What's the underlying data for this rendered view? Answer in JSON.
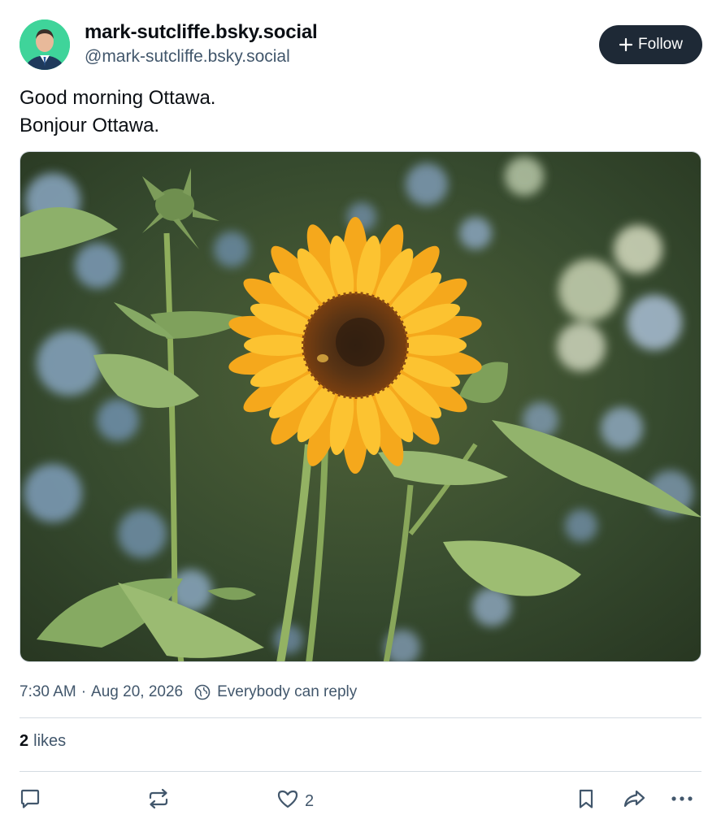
{
  "author": {
    "display_name": "mark-sutcliffe.bsky.social",
    "handle": "@mark-sutcliffe.bsky.social",
    "avatar_icon": "user-avatar",
    "avatar_bg": "#3fd49a"
  },
  "follow_button": {
    "label": "Follow",
    "icon": "plus-icon",
    "bg": "#1e2936"
  },
  "post": {
    "lines": [
      "Good morning Ottawa.",
      "Bonjour Ottawa."
    ],
    "image_icon": "sunflower-photo"
  },
  "meta": {
    "time": "7:30 AM",
    "separator": "·",
    "date": "Aug 20, 2026",
    "reply_setting_icon": "globe-icon",
    "reply_setting": "Everybody can reply"
  },
  "stats": {
    "likes_count": "2",
    "likes_label": "likes"
  },
  "actions": {
    "reply_icon": "comment-icon",
    "repost_icon": "repost-icon",
    "like_icon": "heart-icon",
    "like_count": "2",
    "bookmark_icon": "bookmark-icon",
    "share_icon": "share-icon",
    "more_icon": "ellipsis-icon"
  },
  "colors": {
    "text_primary": "#0b0f14",
    "text_secondary": "#42576c",
    "divider": "#d4dbe2"
  }
}
